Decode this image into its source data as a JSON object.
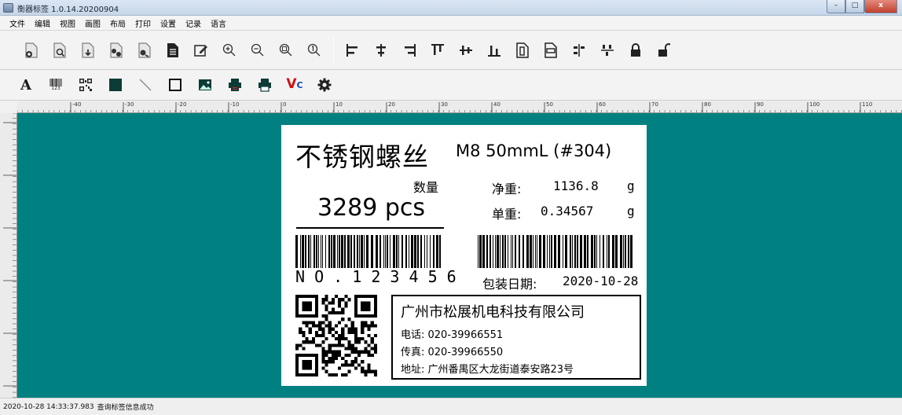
{
  "window": {
    "title": "衡器标签 1.0.14.20200904",
    "minimize": "–",
    "maximize": "□",
    "close": "x"
  },
  "menu": [
    "文件",
    "编辑",
    "视图",
    "画图",
    "布局",
    "打印",
    "设置",
    "记录",
    "语言"
  ],
  "toolbar1": {
    "groups": [
      [
        "new-icon",
        "open-icon",
        "import-icon",
        "save-icon",
        "save-as-icon",
        "document-icon",
        "edit-icon",
        "zoom-in-icon",
        "zoom-out-icon",
        "zoom-fit-icon",
        "zoom-actual-icon"
      ],
      [
        "align-left-icon",
        "align-center-h-icon",
        "align-right-icon",
        "align-top-icon",
        "align-center-v-icon",
        "align-bottom-icon",
        "same-width-icon",
        "same-height-icon",
        "distribute-h-icon",
        "distribute-v-icon",
        "lock-icon",
        "unlock-icon"
      ]
    ]
  },
  "toolbar2": {
    "tools": [
      "text-icon",
      "barcode-icon",
      "qrcode-icon",
      "rectangle-fill-icon",
      "line-icon",
      "rectangle-icon",
      "image-icon",
      "print-preview-icon",
      "print-icon",
      "variable-icon",
      "settings-icon"
    ],
    "text_tool_glyph": "A",
    "barcode_caption": "123",
    "variable_glyph_main": "V",
    "variable_glyph_sub": "C"
  },
  "ruler": {
    "top_ticks": [
      "-40",
      "-30",
      "-20",
      "-10",
      "0",
      "10",
      "20",
      "30",
      "40",
      "50",
      "60",
      "70",
      "80",
      "90",
      "100",
      "110"
    ]
  },
  "label": {
    "product_name": "不锈钢螺丝",
    "spec": "M8 50mmL (#304)",
    "qty_label": "数量",
    "qty_value": "3289 pcs",
    "net_weight_label": "净重:",
    "net_weight_value": "1136.8",
    "net_weight_unit": "g",
    "unit_weight_label": "单重:",
    "unit_weight_value": "0.34567",
    "unit_weight_unit": "g",
    "barcode1_text": "N O . 1 2 3 4 5 6",
    "pack_date_label": "包装日期:",
    "pack_date_value": "2020-10-28",
    "company": "广州市松展机电科技有限公司",
    "phone": "电话: 020-39966551",
    "fax": "传真: 020-39966550",
    "address": "地址: 广州番禺区大龙街道泰安路23号"
  },
  "status": {
    "timestamp": "2020-10-28 14:33:37.983",
    "message": "查询标签信息成功"
  }
}
